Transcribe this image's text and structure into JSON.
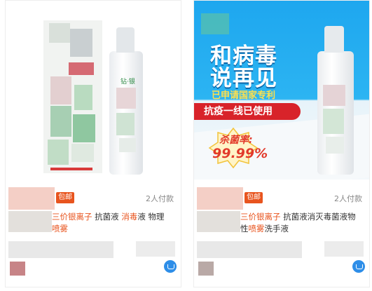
{
  "products": [
    {
      "tag": "包邮",
      "paid_count": "2人付款",
      "title_prefix": "三价银离子",
      "title_mid": " 抗菌液 ",
      "title_hl2": "消毒",
      "title_rest": "液 物理",
      "title_line2": "喷雾",
      "brand_on_bottle": "钻·银"
    },
    {
      "tag": "包邮",
      "paid_count": "2人付款",
      "title_prefix": "三价银离子",
      "title_mid": " 抗菌液消灭毒菌液物",
      "title_line2a": "性",
      "title_line2b": "喷雾",
      "title_line2c": "洗手液",
      "poster": {
        "headline_line1": "和病毒",
        "headline_line2": "说再见",
        "patent": "已申请国家专利",
        "banner": "抗疫一线已使用",
        "badge_line1": "杀菌率:",
        "badge_line2": "99.99%"
      }
    }
  ],
  "colors": {
    "accent": "#e8541e",
    "poster_blue": "#1ea7ef",
    "banner_red": "#d8232a",
    "cart_blue": "#2e8ee8"
  },
  "icons": [
    "cart-icon"
  ]
}
